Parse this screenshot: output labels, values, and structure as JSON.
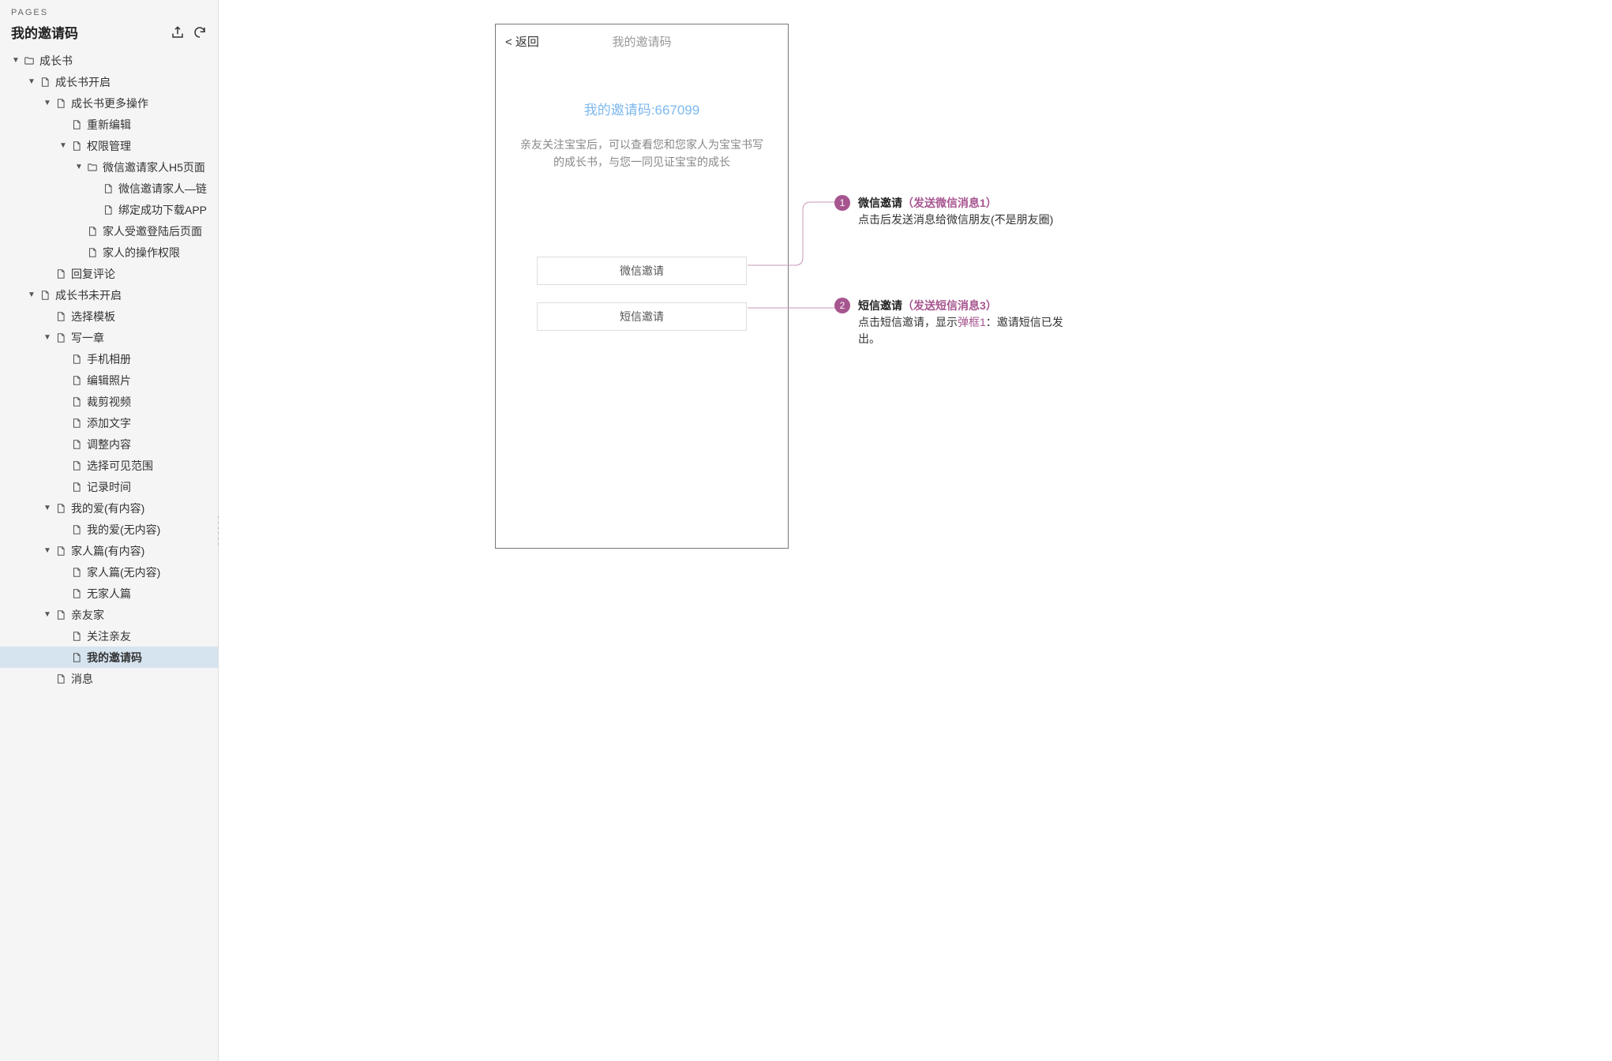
{
  "sidebar": {
    "header": "PAGES",
    "title": "我的邀请码",
    "tree": [
      {
        "depth": 0,
        "caret": "down",
        "icon": "folder",
        "label": "成长书"
      },
      {
        "depth": 1,
        "caret": "down",
        "icon": "page",
        "label": "成长书开启"
      },
      {
        "depth": 2,
        "caret": "down",
        "icon": "page",
        "label": "成长书更多操作"
      },
      {
        "depth": 3,
        "caret": "none",
        "icon": "page",
        "label": "重新编辑"
      },
      {
        "depth": 3,
        "caret": "down",
        "icon": "page",
        "label": "权限管理"
      },
      {
        "depth": 4,
        "caret": "down",
        "icon": "folder",
        "label": "微信邀请家人H5页面"
      },
      {
        "depth": 5,
        "caret": "none",
        "icon": "page",
        "label": "微信邀请家人—链"
      },
      {
        "depth": 5,
        "caret": "none",
        "icon": "page",
        "label": "绑定成功下载APP"
      },
      {
        "depth": 4,
        "caret": "none",
        "icon": "page",
        "label": "家人受邀登陆后页面"
      },
      {
        "depth": 4,
        "caret": "none",
        "icon": "page",
        "label": "家人的操作权限"
      },
      {
        "depth": 2,
        "caret": "none",
        "icon": "page",
        "label": "回复评论"
      },
      {
        "depth": 1,
        "caret": "down",
        "icon": "page",
        "label": "成长书未开启"
      },
      {
        "depth": 2,
        "caret": "none",
        "icon": "page",
        "label": "选择模板"
      },
      {
        "depth": 2,
        "caret": "down",
        "icon": "page",
        "label": "写一章"
      },
      {
        "depth": 3,
        "caret": "none",
        "icon": "page",
        "label": "手机相册"
      },
      {
        "depth": 3,
        "caret": "none",
        "icon": "page",
        "label": "编辑照片"
      },
      {
        "depth": 3,
        "caret": "none",
        "icon": "page",
        "label": "裁剪视频"
      },
      {
        "depth": 3,
        "caret": "none",
        "icon": "page",
        "label": "添加文字"
      },
      {
        "depth": 3,
        "caret": "none",
        "icon": "page",
        "label": "调整内容"
      },
      {
        "depth": 3,
        "caret": "none",
        "icon": "page",
        "label": "选择可见范围"
      },
      {
        "depth": 3,
        "caret": "none",
        "icon": "page",
        "label": "记录时间"
      },
      {
        "depth": 2,
        "caret": "down",
        "icon": "page",
        "label": "我的爱(有内容)"
      },
      {
        "depth": 3,
        "caret": "none",
        "icon": "page",
        "label": "我的爱(无内容)"
      },
      {
        "depth": 2,
        "caret": "down",
        "icon": "page",
        "label": "家人篇(有内容)"
      },
      {
        "depth": 3,
        "caret": "none",
        "icon": "page",
        "label": "家人篇(无内容)"
      },
      {
        "depth": 3,
        "caret": "none",
        "icon": "page",
        "label": "无家人篇"
      },
      {
        "depth": 2,
        "caret": "down",
        "icon": "page",
        "label": "亲友家"
      },
      {
        "depth": 3,
        "caret": "none",
        "icon": "page",
        "label": "关注亲友"
      },
      {
        "depth": 3,
        "caret": "none",
        "icon": "page",
        "label": "我的邀请码",
        "selected": true
      },
      {
        "depth": 2,
        "caret": "none",
        "icon": "page",
        "label": "消息"
      }
    ]
  },
  "mockup": {
    "back": "< 返回",
    "title": "我的邀请码",
    "invite_code": "我的邀请码:667099",
    "invite_desc": "亲友关注宝宝后，可以查看您和您家人为宝宝书写的成长书，与您一同见证宝宝的成长",
    "btn1": "微信邀请",
    "btn2": "短信邀请"
  },
  "annotations": {
    "a1": {
      "num": "1",
      "title": "微信邀请",
      "action": "（发送微信消息1）",
      "body": "点击后发送消息给微信朋友(不是朋友圈)"
    },
    "a2": {
      "num": "2",
      "title": "短信邀请",
      "action": "（发送短信消息3）",
      "body_pre": "点击短信邀请，显示",
      "body_link": "弹框1",
      "body_post": "：邀请短信已发出。"
    }
  }
}
